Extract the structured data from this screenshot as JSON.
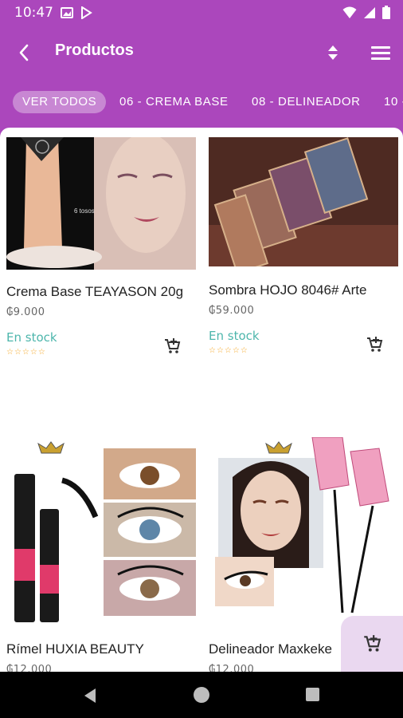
{
  "status_bar": {
    "time": "10:47"
  },
  "app_bar": {
    "title": "Productos"
  },
  "chips": [
    "VER TODOS",
    "06 - CREMA BASE",
    "08 - DELINEADOR",
    "10 -"
  ],
  "products": [
    {
      "name": "Crema Base TEAYASON 20g",
      "price": "₲9.000",
      "stock": "En stock",
      "stars": "☆☆☆☆☆"
    },
    {
      "name": "Sombra HOJO 8046# Arte",
      "price": "₲59.000",
      "stock": "En stock",
      "stars": "☆☆☆☆☆"
    },
    {
      "name": "Rímel HUXIA BEAUTY",
      "price": "₲12.000"
    },
    {
      "name": "Delineador Maxkeke",
      "price": "₲12.000"
    }
  ],
  "colors": {
    "primary": "#ab47bc",
    "stock": "#4db6ac",
    "stars": "#f5a623",
    "fab_bg": "#ead8f0"
  },
  "icons": [
    "back-arrow-icon",
    "sort-icon",
    "menu-icon",
    "add-to-cart-icon",
    "wifi-icon",
    "signal-icon",
    "battery-icon"
  ]
}
